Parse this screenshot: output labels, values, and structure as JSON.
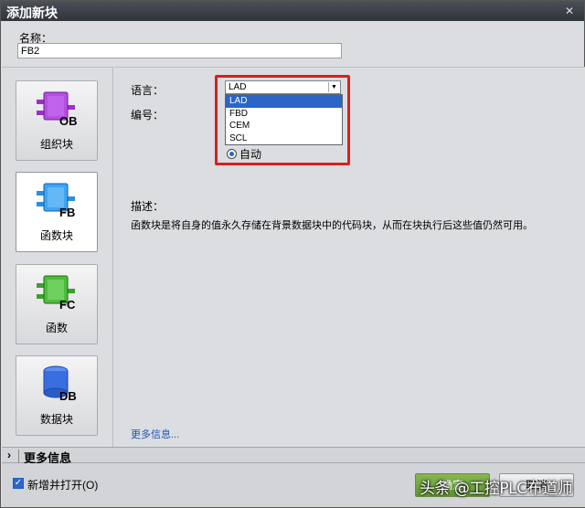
{
  "window": {
    "title": "添加新块",
    "close_glyph": "✕"
  },
  "name_field": {
    "label": "名称：",
    "value": "FB2"
  },
  "block_types": [
    {
      "id": "ob",
      "tag": "OB",
      "label": "组织块",
      "color": "#9b30c8"
    },
    {
      "id": "fb",
      "tag": "FB",
      "label": "函数块",
      "color": "#2a8fe0"
    },
    {
      "id": "fc",
      "tag": "FC",
      "label": "函数",
      "color": "#3aa12c"
    },
    {
      "id": "db",
      "tag": "DB",
      "label": "数据块",
      "color": "#2c62d6"
    }
  ],
  "language": {
    "label": "语言：",
    "selected": "LAD",
    "options": [
      "LAD",
      "FBD",
      "CEM",
      "SCL"
    ]
  },
  "number": {
    "label": "编号：",
    "auto_label": "自动"
  },
  "description": {
    "label": "描述：",
    "text": "函数块是将自身的值永久存储在背景数据块中的代码块，从而在块执行后这些值仍然可用。"
  },
  "more_info_link": "更多信息...",
  "more_info_bar": "更多信息",
  "footer": {
    "add_open_label": "新增并打开(O)",
    "ok_label": "确定",
    "cancel_label": "取消"
  },
  "watermark": "头条 @工控PLC布道师",
  "colors": {
    "accent": "#2b66c7",
    "ok_green": "#6ea83c",
    "highlight_red": "#d81f1f"
  }
}
